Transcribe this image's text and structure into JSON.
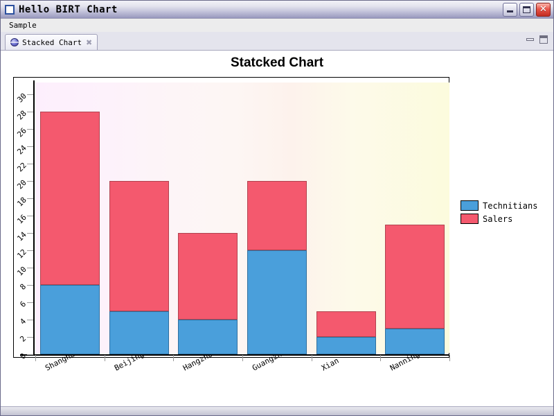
{
  "window": {
    "title": "Hello BIRT Chart",
    "icon": "app-square-icon",
    "controls": {
      "minimize": "minimize-icon",
      "maximize": "maximize-icon",
      "close": "✕"
    }
  },
  "menu": {
    "items": [
      {
        "label": "Sample"
      }
    ]
  },
  "tab": {
    "label": "Stacked Chart",
    "icon": "globe-icon",
    "close": "✖",
    "view_controls": {
      "minimize": "view-minimize-icon",
      "maximize": "view-maximize-icon"
    }
  },
  "legend": {
    "position": "right",
    "entries": [
      {
        "label": "Technitians",
        "color": "#4A9FDB"
      },
      {
        "label": "Salers",
        "color": "#F4596E"
      }
    ]
  },
  "chart_data": {
    "type": "bar",
    "stacked": true,
    "title": "Statcked Chart",
    "xlabel": "",
    "ylabel": "",
    "ylim": [
      0,
      30
    ],
    "ytick_step": 2,
    "yticks": [
      0,
      2,
      4,
      6,
      8,
      10,
      12,
      14,
      16,
      18,
      20,
      22,
      24,
      26,
      28,
      30
    ],
    "grid": false,
    "categories": [
      "Shanghai",
      "Beijing",
      "Hangzhou",
      "Guangzhou",
      "Xian",
      "Nanning"
    ],
    "series": [
      {
        "name": "Technitians",
        "color": "#4A9FDB",
        "values": [
          8,
          5,
          4,
          12,
          2,
          3
        ]
      },
      {
        "name": "Salers",
        "color": "#F4596E",
        "values": [
          20,
          15,
          10,
          8,
          3,
          12
        ]
      }
    ],
    "totals": [
      28,
      20,
      14,
      20,
      5,
      15
    ]
  }
}
